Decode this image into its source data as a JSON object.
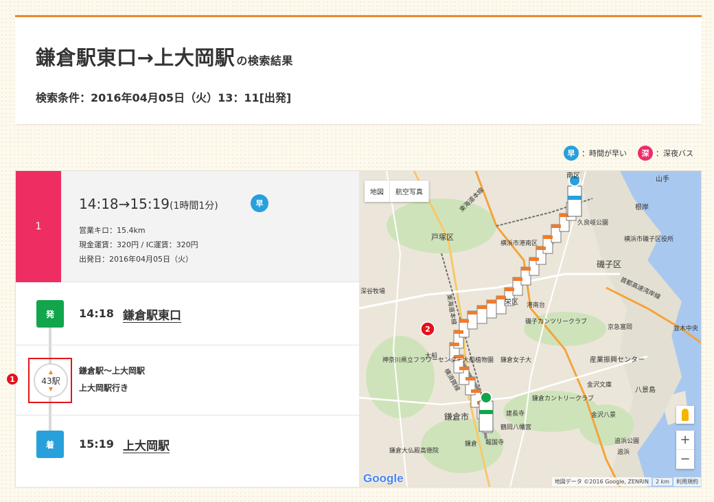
{
  "header": {
    "title": "鎌倉駅東口→上大岡駅",
    "title_suffix": "の検索結果",
    "conditions": "検索条件：2016年04月05日（火）13：11[出発]"
  },
  "legend": {
    "fast_badge": "早",
    "fast_label": "：時間が早い",
    "night_badge": "深",
    "night_label": "：深夜バス"
  },
  "route": {
    "number": "1",
    "time_range": "14:18→15:19",
    "duration": "(1時間1分)",
    "fast_badge": "早",
    "distance": "営業キロ：15.4km",
    "fare": "現金運賃：320円 / IC運賃：320円",
    "date": "出発日：2016年04月05日（火）"
  },
  "departure": {
    "badge": "発",
    "time": "14:18",
    "stop": "鎌倉駅東口"
  },
  "ride": {
    "stops_count": "43駅",
    "segment": "鎌倉駅〜上大岡駅",
    "destination": "上大岡駅行き"
  },
  "arrival": {
    "badge": "着",
    "time": "15:19",
    "stop": "上大岡駅"
  },
  "annotations": {
    "marker1": "1",
    "marker2": "2"
  },
  "map": {
    "tab_map": "地図",
    "tab_satellite": "航空写真",
    "zoom_in": "+",
    "zoom_out": "−",
    "attribution": "地図データ ©2016 Google, ZENRIN",
    "scale": "2 km",
    "terms": "利用規約",
    "logo": "Google",
    "labels": {
      "minamiku": "南区",
      "yamate": "山手",
      "negishi": "根岸",
      "kugui": "久良岐公園",
      "totsuka": "戸塚区",
      "konan": "横浜市港南区",
      "isogo_office": "横浜市磯子区役所",
      "isogo": "磯子区",
      "tokaido": "東海道本線",
      "sakae": "栄区",
      "fukadani": "深谷牧場",
      "kanagawa_flower": "神奈川県立フラワーセンター大船植物園",
      "kamakura_girls": "鎌倉女子大",
      "kamakura_city": "鎌倉市",
      "kanazawa_bunko": "金沢文庫",
      "sangyo": "産業振興センター",
      "hakkeijima": "八景島",
      "kanazawa_hakkei": "金沢八景",
      "oppama": "追浜公園",
      "oppama2": "追浜",
      "kamakura_station": "鎌倉",
      "daibutsu": "鎌倉大仏殿高徳院",
      "hokokuji": "報国寺",
      "tsurugaoka": "鶴岡八幡宮",
      "kenchoji": "建長寺",
      "kamakura_country": "鎌倉カントリークラブ",
      "isogo_country": "磯子カンツリークラブ",
      "namiki": "並木中央",
      "keikyu_tomioka": "京急富岡",
      "shuto": "首都高速湾岸線",
      "ofuna": "大船",
      "yokosuka_line": "横須賀線",
      "konan_dai": "港南台"
    }
  }
}
